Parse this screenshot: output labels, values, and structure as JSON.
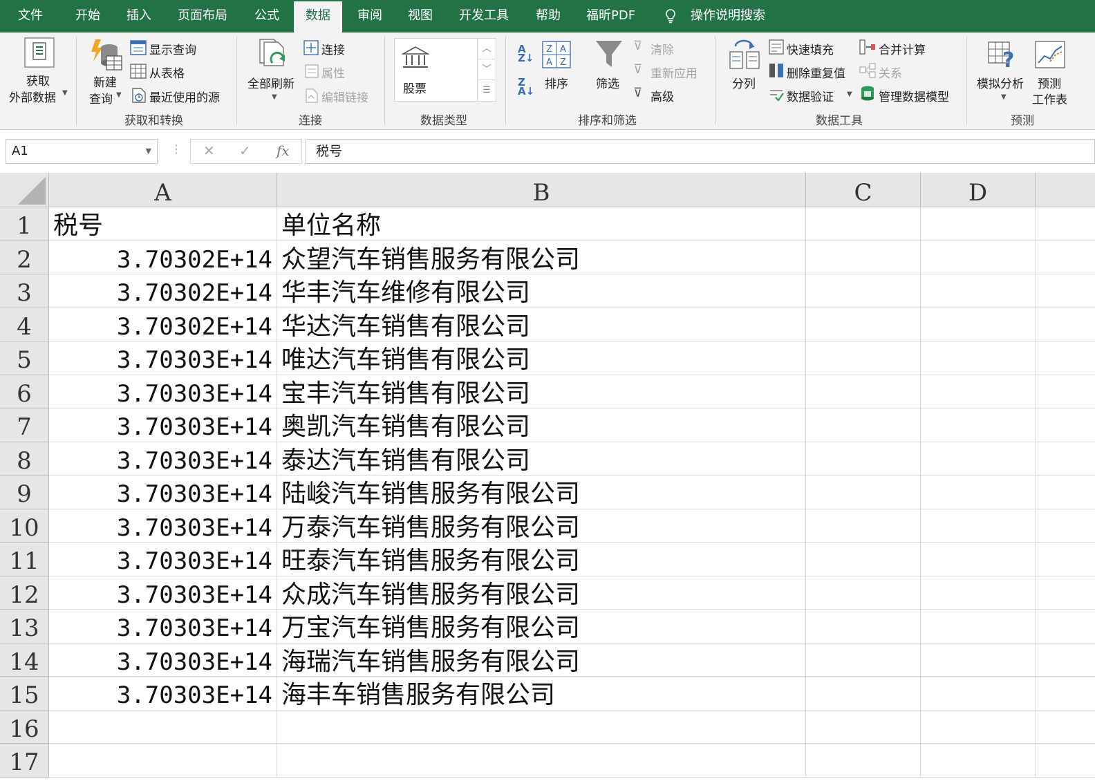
{
  "tabs": [
    {
      "label": "文件",
      "active": false
    },
    {
      "label": "开始",
      "active": false
    },
    {
      "label": "插入",
      "active": false
    },
    {
      "label": "页面布局",
      "active": false
    },
    {
      "label": "公式",
      "active": false
    },
    {
      "label": "数据",
      "active": true
    },
    {
      "label": "审阅",
      "active": false
    },
    {
      "label": "视图",
      "active": false
    },
    {
      "label": "开发工具",
      "active": false
    },
    {
      "label": "帮助",
      "active": false
    },
    {
      "label": "福昕PDF",
      "active": false
    }
  ],
  "tell_me": "操作说明搜索",
  "ribbon": {
    "get_transform": {
      "group_label": "获取和转换",
      "get_external_line1": "获取",
      "get_external_line2": "外部数据",
      "new_query_line1": "新建",
      "new_query_line2": "查询",
      "show_queries": "显示查询",
      "from_table": "从表格",
      "recent_sources": "最近使用的源"
    },
    "connections": {
      "group_label": "连接",
      "refresh_all": "全部刷新",
      "connections": "连接",
      "properties": "属性",
      "edit_links": "编辑链接"
    },
    "data_types": {
      "group_label": "数据类型",
      "stocks": "股票"
    },
    "sort_filter": {
      "group_label": "排序和筛选",
      "sort": "排序",
      "filter": "筛选",
      "clear": "清除",
      "reapply": "重新应用",
      "advanced": "高级"
    },
    "data_tools": {
      "group_label": "数据工具",
      "text_to_columns": "分列",
      "flash_fill": "快速填充",
      "remove_duplicates": "删除重复值",
      "data_validation": "数据验证",
      "consolidate": "合并计算",
      "relationships": "关系",
      "manage_data_model": "管理数据模型"
    },
    "forecast": {
      "group_label": "预测",
      "what_if_line1": "模拟分析",
      "forecast_sheet_line1": "预测",
      "forecast_sheet_line2": "工作表"
    }
  },
  "formula_bar": {
    "name_box": "A1",
    "fx": "fx",
    "content": "税号"
  },
  "sheet": {
    "columns": [
      "A",
      "B",
      "C",
      "D"
    ],
    "row_numbers": [
      "1",
      "2",
      "3",
      "4",
      "5",
      "6",
      "7",
      "8",
      "9",
      "10",
      "11",
      "12",
      "13",
      "14",
      "15",
      "16",
      "17"
    ],
    "rows": [
      {
        "a": "税号",
        "b": "单位名称"
      },
      {
        "a": "3.70302E+14",
        "b": "众望汽车销售服务有限公司"
      },
      {
        "a": "3.70302E+14",
        "b": "华丰汽车维修有限公司"
      },
      {
        "a": "3.70302E+14",
        "b": "华达汽车销售有限公司"
      },
      {
        "a": "3.70303E+14",
        "b": "唯达汽车销售有限公司"
      },
      {
        "a": "3.70303E+14",
        "b": "宝丰汽车销售有限公司"
      },
      {
        "a": "3.70303E+14",
        "b": "奥凯汽车销售有限公司"
      },
      {
        "a": "3.70303E+14",
        "b": "泰达汽车销售有限公司"
      },
      {
        "a": "3.70303E+14",
        "b": "陆峻汽车销售服务有限公司"
      },
      {
        "a": "3.70303E+14",
        "b": "万泰汽车销售服务有限公司"
      },
      {
        "a": "3.70303E+14",
        "b": "旺泰汽车销售服务有限公司"
      },
      {
        "a": "3.70303E+14",
        "b": "众成汽车销售服务有限公司"
      },
      {
        "a": "3.70303E+14",
        "b": "万宝汽车销售服务有限公司"
      },
      {
        "a": "3.70303E+14",
        "b": "海瑞汽车销售服务有限公司"
      },
      {
        "a": "3.70303E+14",
        "b": "海丰车销售服务有限公司"
      },
      {
        "a": "",
        "b": ""
      },
      {
        "a": "",
        "b": ""
      }
    ]
  },
  "colors": {
    "accent": "#217346",
    "ribbon_bg": "#f3f3f3",
    "header_bg": "#e6e6e6",
    "gridline": "#d9d9d9"
  }
}
